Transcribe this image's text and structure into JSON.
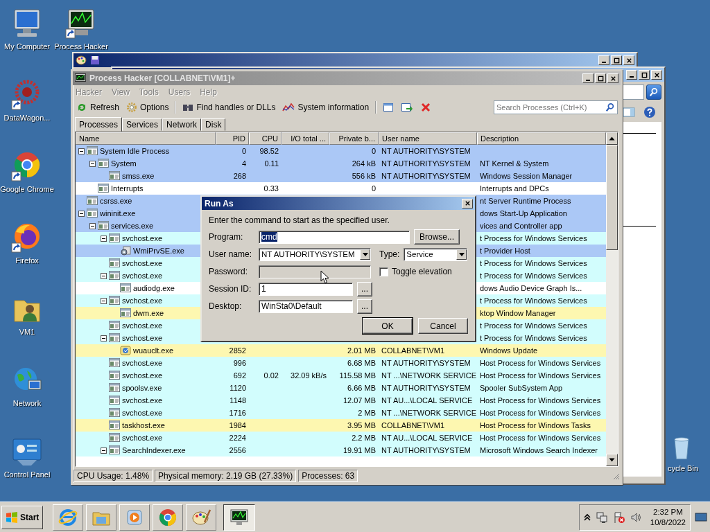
{
  "desktop_icons": [
    {
      "label": "My Computer",
      "kind": "computer",
      "shortcut": false
    },
    {
      "label": "Process Hacker",
      "kind": "process-hacker",
      "shortcut": true
    },
    {
      "label": "DataWagon...",
      "kind": "datawagon",
      "shortcut": true
    },
    {
      "label": "Google Chrome",
      "kind": "chrome",
      "shortcut": true
    },
    {
      "label": "Firefox",
      "kind": "firefox",
      "shortcut": true
    },
    {
      "label": "VM1",
      "kind": "user-folder",
      "shortcut": false
    },
    {
      "label": "Network",
      "kind": "network",
      "shortcut": false
    },
    {
      "label": "Control Panel",
      "kind": "control-panel",
      "shortcut": false
    }
  ],
  "recycle_bin": {
    "label": "cycle Bin"
  },
  "background_windows": [
    {
      "kind": "paint"
    },
    {
      "kind": "explorer"
    }
  ],
  "process_hacker": {
    "title": "Process Hacker [COLLABNET\\VM1]+",
    "menu": [
      "Hacker",
      "View",
      "Tools",
      "Users",
      "Help"
    ],
    "toolbar": [
      {
        "kind": "refresh",
        "label": "Refresh"
      },
      {
        "kind": "options",
        "label": "Options"
      },
      {
        "kind": "separator"
      },
      {
        "kind": "find",
        "label": "Find handles or DLLs"
      },
      {
        "kind": "sysinfo",
        "label": "System information"
      },
      {
        "kind": "separator"
      },
      {
        "kind": "window"
      },
      {
        "kind": "export"
      },
      {
        "kind": "terminate"
      }
    ],
    "search": {
      "placeholder": "Search Processes (Ctrl+K)"
    },
    "tabs": [
      {
        "label": "Processes",
        "selected": true
      },
      {
        "label": "Services",
        "selected": false
      },
      {
        "label": "Network",
        "selected": false
      },
      {
        "label": "Disk",
        "selected": false
      }
    ],
    "columns": [
      "Name",
      "PID",
      "CPU",
      "I/O total ...",
      "Private b...",
      "User name",
      "Description"
    ],
    "rows": [
      {
        "name": "System Idle Process",
        "kind": "app",
        "pid": "0",
        "cpu": "98.52",
        "private_bytes": "0",
        "user_name": "NT AUTHORITY\\SYSTEM",
        "color": "#abc8f6",
        "expanded": true,
        "children": [
          {
            "name": "System",
            "kind": "app",
            "pid": "4",
            "cpu": "0.11",
            "private_bytes": "264 kB",
            "user_name": "NT AUTHORITY\\SYSTEM",
            "description": "NT Kernel & System",
            "color": "#abc8f6",
            "expanded": true,
            "children": [
              {
                "name": "smss.exe",
                "kind": "app",
                "pid": "268",
                "private_bytes": "556 kB",
                "user_name": "NT AUTHORITY\\SYSTEM",
                "description": "Windows Session Manager",
                "color": "#abc8f6"
              }
            ]
          },
          {
            "name": "Interrupts",
            "kind": "app",
            "cpu": "0.33",
            "private_bytes": "0",
            "description": "Interrupts and DPCs",
            "color": "#ffffff"
          }
        ]
      },
      {
        "name": "csrss.exe",
        "kind": "app",
        "description": "nt Server Runtime Process",
        "color": "#abc8f6"
      },
      {
        "name": "wininit.exe",
        "kind": "app",
        "description": "dows Start-Up Application",
        "color": "#abc8f6",
        "expanded": true,
        "children": [
          {
            "name": "services.exe",
            "kind": "app",
            "description": "vices and Controller app",
            "color": "#abc8f6",
            "expanded": true,
            "children": [
              {
                "name": "svchost.exe",
                "kind": "app",
                "description": "t Process for Windows Services",
                "color": "#d2fdfd",
                "expanded": true,
                "children": [
                  {
                    "name": "WmiPrvSE.exe",
                    "kind": "wmi",
                    "description": "t Provider Host",
                    "color": "#abc8f6"
                  }
                ]
              },
              {
                "name": "svchost.exe",
                "kind": "app",
                "description": "t Process for Windows Services",
                "color": "#d2fdfd"
              },
              {
                "name": "svchost.exe",
                "kind": "app",
                "description": "t Process for Windows Services",
                "color": "#d2fdfd",
                "expanded": true,
                "children": [
                  {
                    "name": "audiodg.exe",
                    "kind": "app",
                    "description": "dows Audio Device Graph Is...",
                    "color": "#ffffff"
                  }
                ]
              },
              {
                "name": "svchost.exe",
                "kind": "app",
                "description": "t Process for Windows Services",
                "color": "#d2fdfd",
                "expanded": true,
                "children": [
                  {
                    "name": "dwm.exe",
                    "kind": "app",
                    "description": "ktop Window Manager",
                    "color": "#fdf7b0"
                  }
                ]
              },
              {
                "name": "svchost.exe",
                "kind": "app",
                "description": "t Process for Windows Services",
                "color": "#d2fdfd"
              },
              {
                "name": "svchost.exe",
                "kind": "app",
                "description": "t Process for Windows Services",
                "color": "#d2fdfd",
                "expanded": true,
                "children": [
                  {
                    "name": "wuauclt.exe",
                    "kind": "update",
                    "pid": "2852",
                    "private_bytes": "2.01 MB",
                    "user_name": "COLLABNET\\VM1",
                    "description": "Windows Update",
                    "color": "#fdf7b0"
                  }
                ]
              },
              {
                "name": "svchost.exe",
                "kind": "app",
                "pid": "996",
                "private_bytes": "6.68 MB",
                "user_name": "NT AUTHORITY\\SYSTEM",
                "description": "Host Process for Windows Services",
                "color": "#d2fdfd"
              },
              {
                "name": "svchost.exe",
                "kind": "app",
                "pid": "692",
                "cpu": "0.02",
                "io_total": "32.09 kB/s",
                "private_bytes": "115.58 MB",
                "user_name": "NT ...\\NETWORK SERVICE",
                "description": "Host Process for Windows Services",
                "color": "#d2fdfd"
              },
              {
                "name": "spoolsv.exe",
                "kind": "app",
                "pid": "1120",
                "private_bytes": "6.66 MB",
                "user_name": "NT AUTHORITY\\SYSTEM",
                "description": "Spooler SubSystem App",
                "color": "#d2fdfd"
              },
              {
                "name": "svchost.exe",
                "kind": "app",
                "pid": "1148",
                "private_bytes": "12.07 MB",
                "user_name": "NT AU...\\LOCAL SERVICE",
                "description": "Host Process for Windows Services",
                "color": "#d2fdfd"
              },
              {
                "name": "svchost.exe",
                "kind": "app",
                "pid": "1716",
                "private_bytes": "2 MB",
                "user_name": "NT ...\\NETWORK SERVICE",
                "description": "Host Process for Windows Services",
                "color": "#d2fdfd"
              },
              {
                "name": "taskhost.exe",
                "kind": "app",
                "pid": "1984",
                "private_bytes": "3.95 MB",
                "user_name": "COLLABNET\\VM1",
                "description": "Host Process for Windows Tasks",
                "color": "#fdf7b0"
              },
              {
                "name": "svchost.exe",
                "kind": "app",
                "pid": "2224",
                "private_bytes": "2.2 MB",
                "user_name": "NT AU...\\LOCAL SERVICE",
                "description": "Host Process for Windows Services",
                "color": "#d2fdfd"
              },
              {
                "name": "SearchIndexer.exe",
                "kind": "app",
                "pid": "2556",
                "private_bytes": "19.91 MB",
                "user_name": "NT AUTHORITY\\SYSTEM",
                "description": "Microsoft Windows Search Indexer",
                "color": "#d2fdfd",
                "expanded": true
              }
            ]
          }
        ]
      }
    ],
    "status_bar": [
      "CPU Usage: 1.48%",
      "Physical memory: 2.19 GB (27.33%)",
      "Processes: 63"
    ]
  },
  "run_as": {
    "title": "Run As",
    "instruction": "Enter the command to start as the specified user.",
    "program": {
      "label": "Program:",
      "value": "cmd",
      "highlighted": true
    },
    "browse_button": "Browse...",
    "user_name": {
      "label": "User name:",
      "value": "NT AUTHORITY\\SYSTEM"
    },
    "type": {
      "label": "Type:",
      "value": "Service"
    },
    "password": {
      "label": "Password:",
      "disabled": true
    },
    "toggle_elevation": {
      "label": "Toggle elevation",
      "checked": false
    },
    "session_id": {
      "label": "Session ID:",
      "value": "1",
      "button": "..."
    },
    "desktop": {
      "label": "Desktop:",
      "value": "WinSta0\\Default",
      "button": "..."
    },
    "buttons": [
      "OK",
      "Cancel"
    ]
  },
  "taskbar": {
    "start": "Start",
    "quick_launch": [
      {
        "kind": "ie"
      },
      {
        "kind": "explorer"
      },
      {
        "kind": "media-player"
      },
      {
        "kind": "chrome"
      },
      {
        "kind": "paint"
      }
    ],
    "tasks": [
      {
        "kind": "process-hacker",
        "selected": true
      }
    ],
    "tray_icons": [
      {
        "kind": "show-hidden"
      },
      {
        "kind": "network"
      },
      {
        "kind": "action-center"
      },
      {
        "kind": "volume"
      }
    ],
    "time": "2:32 PM",
    "date": "10/8/2022"
  }
}
